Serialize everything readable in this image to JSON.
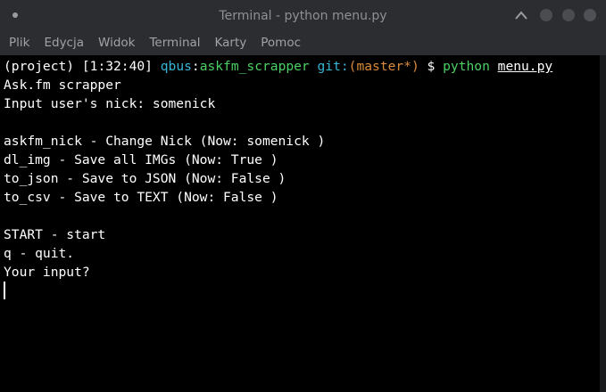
{
  "window": {
    "title": "Terminal - python menu.py"
  },
  "menu": {
    "items": [
      "Plik",
      "Edycja",
      "Widok",
      "Terminal",
      "Karty",
      "Pomoc"
    ]
  },
  "prompt": {
    "env": "(project)",
    "time": "[1:32:40]",
    "user": "qbus",
    "colon": ":",
    "path": "askfm_scrapper",
    "git_label": "git:",
    "branch": "(master*)",
    "symbol": "$",
    "command": "python",
    "arg": "menu.py"
  },
  "output": {
    "lines": [
      "Ask.fm scrapper",
      "Input user's nick: somenick",
      "",
      "askfm_nick - Change Nick (Now: somenick )",
      "dl_img - Save all IMGs (Now: True )",
      "to_json - Save to JSON (Now: False )",
      "to_csv - Save to TEXT (Now: False )",
      "",
      "START - start",
      "q - quit.",
      "Your input?"
    ]
  },
  "colors": {
    "background": "#000000",
    "titlebar": "#2b2d30",
    "prompt_green": "#4bd064",
    "prompt_cyan": "#38b6d8",
    "prompt_orange": "#d98a38"
  }
}
